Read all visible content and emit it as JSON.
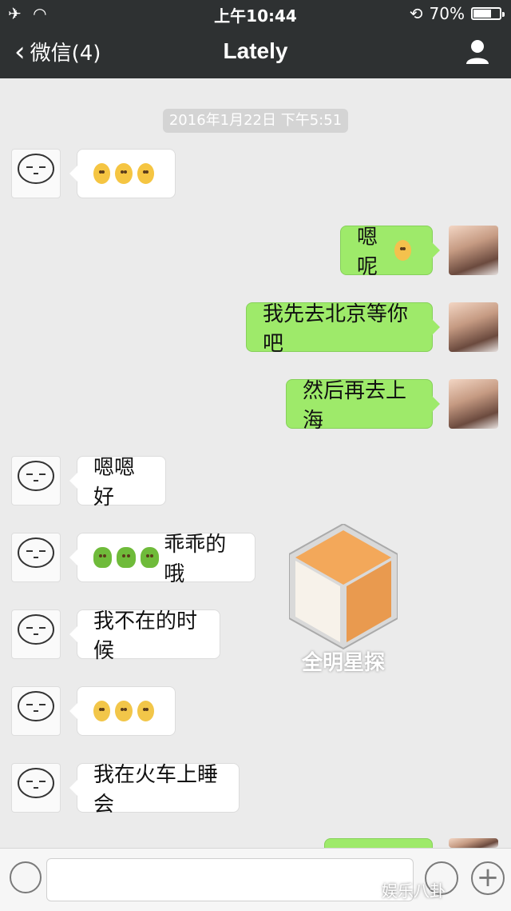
{
  "status_bar": {
    "time": "上午10:44",
    "battery": "70%",
    "battery_level": 0.7
  },
  "nav": {
    "back_label": "微信(4)",
    "title": "Lately"
  },
  "timestamp": "2016年1月22日 下午5:51",
  "messages": [
    {
      "side": "left",
      "emoji": [
        "face",
        "face",
        "face"
      ],
      "text": ""
    },
    {
      "side": "right",
      "text": "嗯呢",
      "emoji_after": "frown-face"
    },
    {
      "side": "right",
      "text": "我先去北京等你吧"
    },
    {
      "side": "right",
      "text": "然后再去上海"
    },
    {
      "side": "left",
      "text": "嗯嗯 好"
    },
    {
      "side": "left",
      "emoji": [
        "green-creature",
        "green-creature",
        "green-creature"
      ],
      "text": "乖乖的哦"
    },
    {
      "side": "left",
      "text": "我不在的时候"
    },
    {
      "side": "left",
      "emoji": [
        "kiss-face",
        "kiss-face",
        "kiss-face"
      ],
      "text": ""
    },
    {
      "side": "left",
      "text": "我在火车上睡会"
    }
  ],
  "watermark": {
    "text": "全明星探"
  },
  "footer_watermark": "娱乐八卦"
}
